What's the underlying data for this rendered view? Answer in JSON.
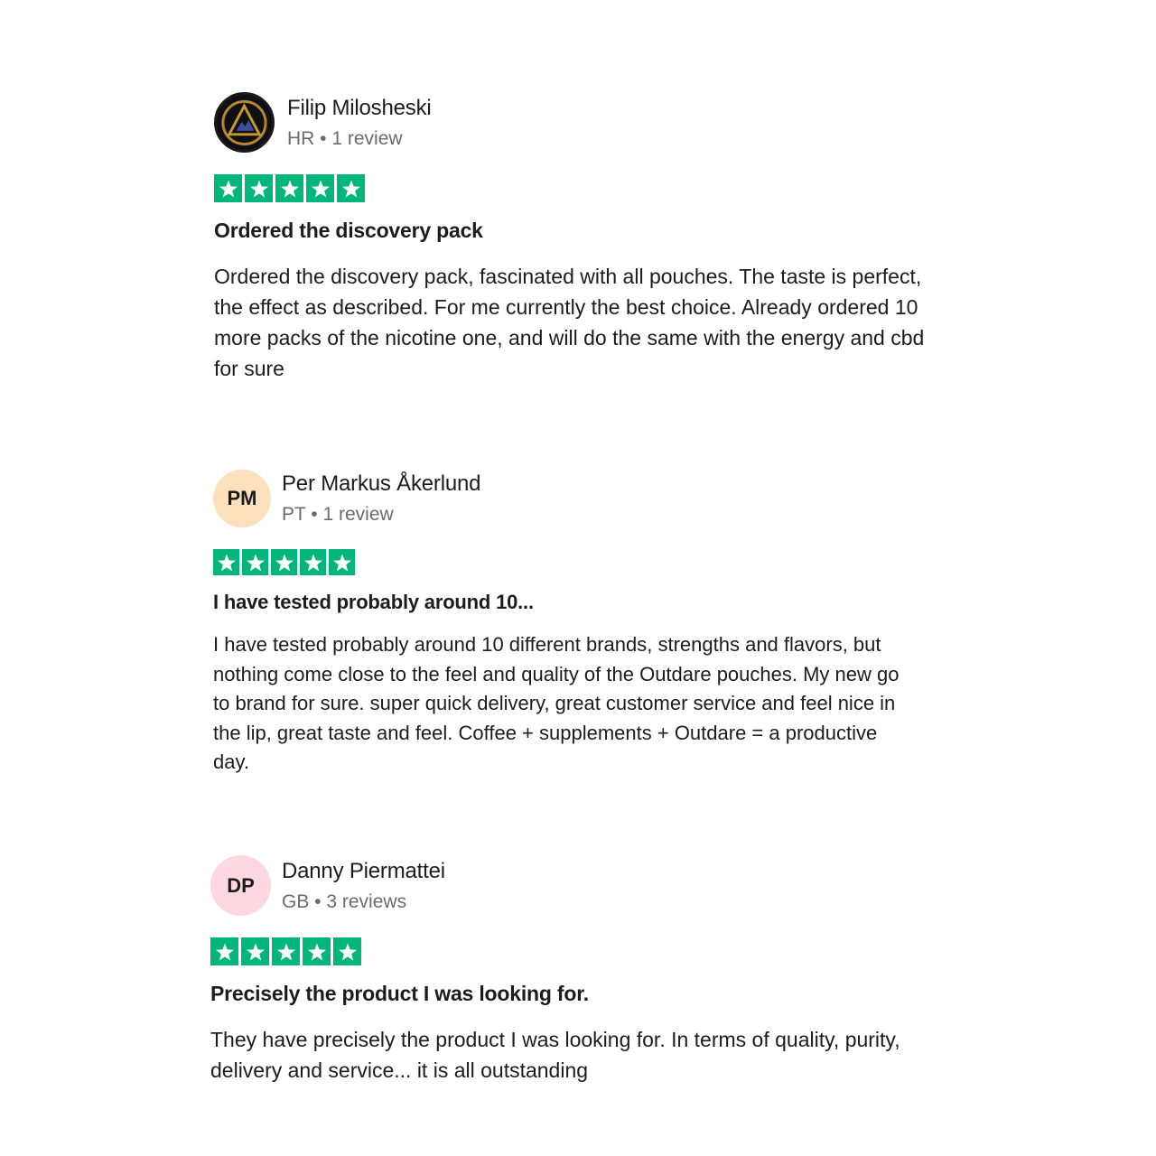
{
  "reviews": [
    {
      "name": "Filip Milosheski",
      "country": "HR",
      "review_count": "1 review",
      "avatar_type": "logo-icon",
      "rating": 5,
      "title": "Ordered the discovery pack",
      "body": "Ordered the discovery pack, fascinated with all pouches. The taste is perfect, the effect as described. For me currently the best choice. Already ordered 10 more packs of the nicotine one, and will do the same with the energy and cbd for sure"
    },
    {
      "name": "Per Markus Åkerlund",
      "country": "PT",
      "review_count": "1 review",
      "initials": "PM",
      "avatar_color": "#fde1bd",
      "rating": 5,
      "title": "I have tested probably around 10...",
      "body": "I have tested probably around 10 different brands, strengths and flavors, but nothing come close to the feel and quality of the Outdare pouches. My new go to brand for sure. super quick delivery, great customer service and feel nice in the lip, great taste and feel. Coffee + supplements + Outdare = a productive day."
    },
    {
      "name": "Danny Piermattei",
      "country": "GB",
      "review_count": "3 reviews",
      "initials": "DP",
      "avatar_color": "#fdd8e1",
      "rating": 5,
      "title": "Precisely the product I was looking for.",
      "body": "They have precisely the product I was looking for. In terms of quality, purity, delivery and service... it is all outstanding"
    }
  ],
  "separator": " • ",
  "star_color": "#00b67a"
}
